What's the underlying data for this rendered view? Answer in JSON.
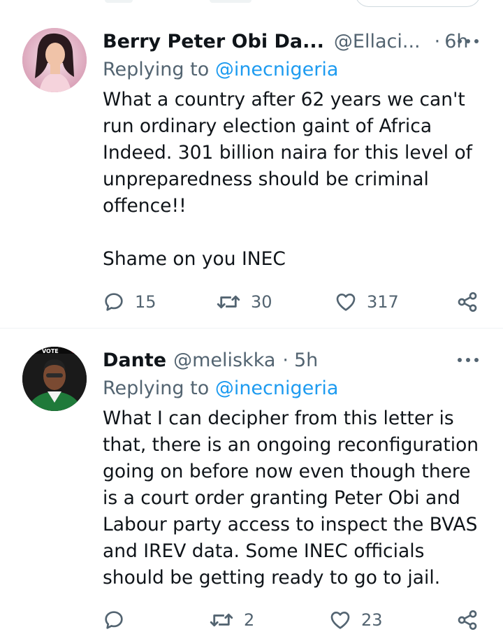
{
  "tweets": [
    {
      "display_name": "Berry Peter Obi Da...",
      "handle": "@Ellaci...",
      "separator": "·",
      "time": "6h",
      "replying_prefix": "Replying to",
      "replying_to": "@inecnigeria",
      "text": "What a country after 62 years we can't run ordinary election gaint of Africa Indeed. 301 billion naira for this level of unpreparedness should be criminal offence!!\n\nShame on you INEC",
      "replies": "15",
      "retweets": "30",
      "likes": "317"
    },
    {
      "display_name": "Dante",
      "handle": "@meliskka",
      "separator": "·",
      "time": "5h",
      "replying_prefix": "Replying to",
      "replying_to": "@inecnigeria",
      "avatar_badge": "VOTE",
      "text": "What I can decipher from this letter is that, there is an ongoing reconfiguration going on before now even though there is a court order granting Peter Obi and Labour party access to inspect the BVAS and IREV data. Some INEC officials should be getting ready to go to jail.",
      "replies": "",
      "retweets": "2",
      "likes": "23"
    }
  ],
  "icons": {
    "reply": "reply-icon",
    "retweet": "retweet-icon",
    "like": "like-icon",
    "share": "share-icon",
    "more": "more-icon"
  },
  "colors": {
    "text": "#0f1419",
    "secondary": "#536471",
    "link": "#1d9bf0",
    "divider": "#eff3f4"
  }
}
